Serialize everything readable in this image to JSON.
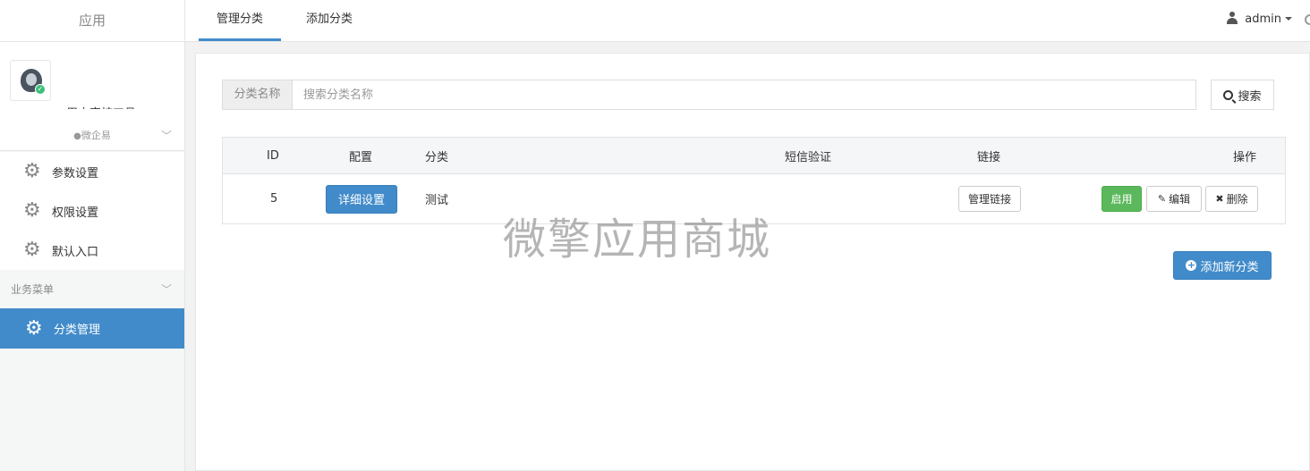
{
  "sidebar": {
    "header": "应用",
    "profile_name": "用户审核工具",
    "group_label": "微企易",
    "menu": [
      {
        "label": "参数设置"
      },
      {
        "label": "权限设置"
      },
      {
        "label": "默认入口"
      }
    ],
    "section_title": "业务菜单",
    "active_item": "分类管理"
  },
  "topbar": {
    "tabs": [
      {
        "label": "管理分类"
      },
      {
        "label": "添加分类"
      }
    ],
    "user": "admin"
  },
  "search": {
    "label": "分类名称",
    "placeholder": "搜索分类名称",
    "value": "",
    "button": "搜索"
  },
  "table": {
    "headers": [
      "ID",
      "配置",
      "分类",
      "短信验证",
      "链接",
      "操作"
    ],
    "rows": [
      {
        "id": "5",
        "config_button": "详细设置",
        "category": "测试",
        "sms": "",
        "link_button": "管理链接",
        "enable_button": "启用",
        "edit_button": "编辑",
        "delete_button": "删除"
      }
    ]
  },
  "add_button": "添加新分类",
  "watermark": "微擎应用商城",
  "colors": {
    "primary": "#428bca",
    "success": "#5cb85c",
    "sidebar_bg": "#f5f6f6"
  }
}
